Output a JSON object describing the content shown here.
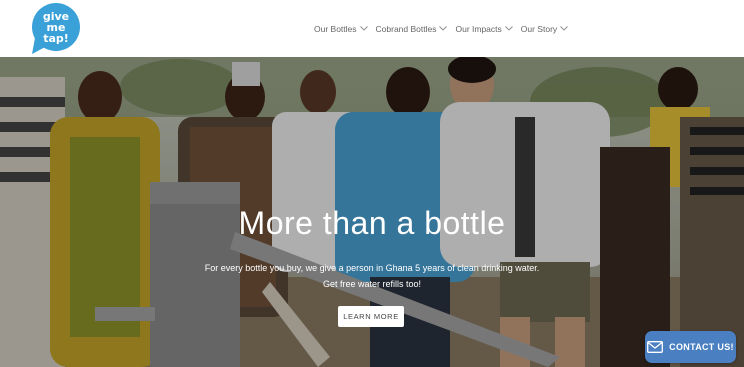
{
  "logo": {
    "text_line1": "give",
    "text_line2": "me",
    "text_line3": "tap!",
    "color": "#3aa0d8"
  },
  "nav": {
    "items": [
      {
        "label": "Our Bottles"
      },
      {
        "label": "Cobrand Bottles"
      },
      {
        "label": "Our Impacts"
      },
      {
        "label": "Our Story"
      }
    ]
  },
  "hero": {
    "title": "More than a bottle",
    "subtitle_line1": "For every bottle you buy, we give a person in Ghana 5 years of clean drinking water.",
    "subtitle_line2": "Get free water refills too!",
    "cta_label": "LEARN MORE"
  },
  "contact": {
    "label": "CONTACT US!",
    "color": "#4a7fc1"
  },
  "icons": [
    "chevron-down-icon",
    "mail-icon"
  ]
}
